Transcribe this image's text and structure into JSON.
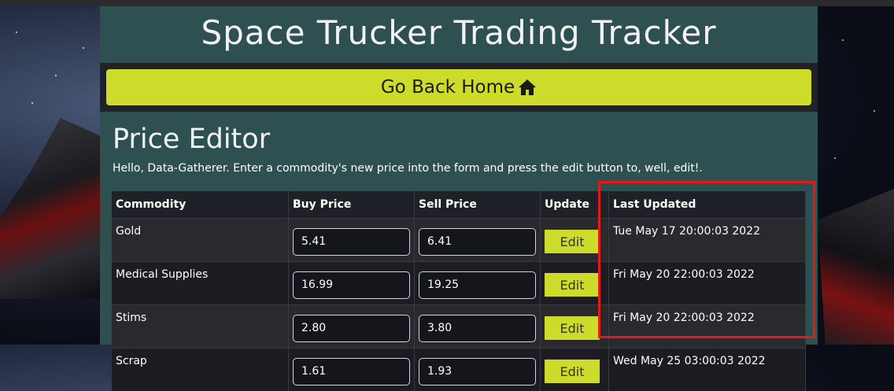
{
  "app": {
    "title": "Space Trucker Trading Tracker",
    "home_button_label": "Go Back Home",
    "home_icon": "home-icon"
  },
  "editor": {
    "heading": "Price Editor",
    "intro": "Hello, Data-Gatherer. Enter a commodity's new price into the form and press the edit button to, well, edit!."
  },
  "table": {
    "headers": [
      "Commodity",
      "Buy Price",
      "Sell Price",
      "Update",
      "Last Updated"
    ],
    "edit_label": "Edit",
    "rows": [
      {
        "commodity": "Gold",
        "buy": "5.41",
        "sell": "6.41",
        "last_updated": "Tue May 17 20:00:03 2022"
      },
      {
        "commodity": "Medical Supplies",
        "buy": "16.99",
        "sell": "19.25",
        "last_updated": "Fri May 20 22:00:03 2022"
      },
      {
        "commodity": "Stims",
        "buy": "2.80",
        "sell": "3.80",
        "last_updated": "Fri May 20 22:00:03 2022"
      },
      {
        "commodity": "Scrap",
        "buy": "1.61",
        "sell": "1.93",
        "last_updated": "Wed May 25 03:00:03 2022"
      }
    ]
  },
  "colors": {
    "accent": "#cddc2a",
    "panel": "#2e5050",
    "highlight": "#e31b1b"
  }
}
